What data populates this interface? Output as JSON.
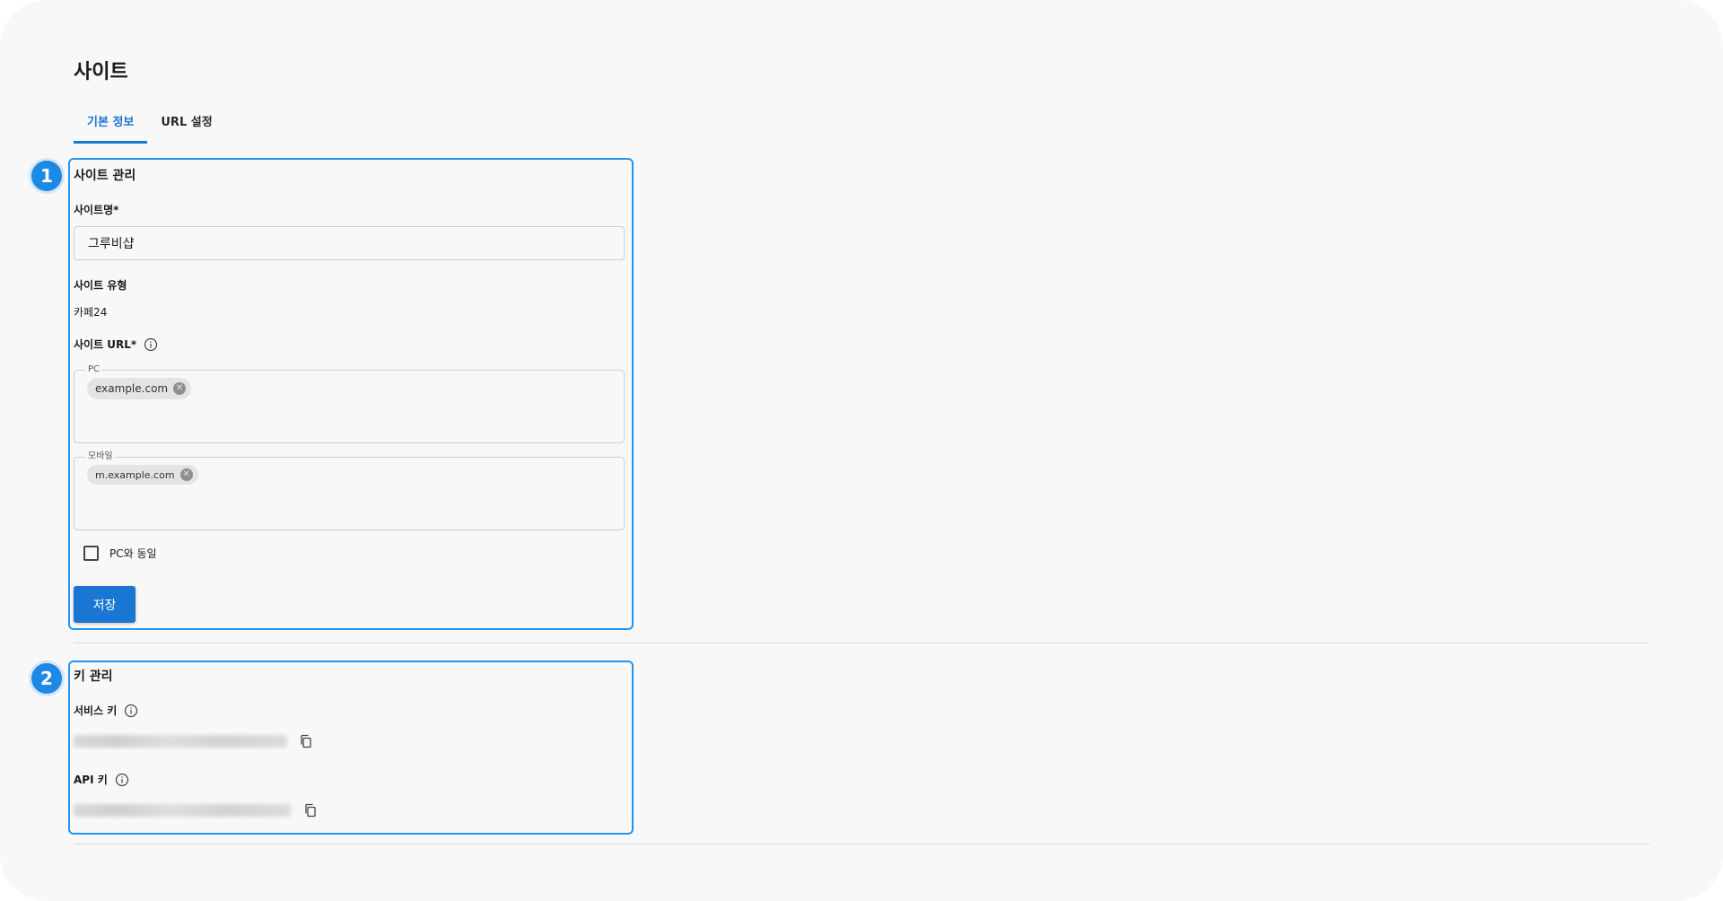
{
  "page": {
    "title": "사이트"
  },
  "tabs": [
    {
      "label": "기본 정보",
      "active": true
    },
    {
      "label": "URL 설정",
      "active": false
    }
  ],
  "markers": [
    "1",
    "2"
  ],
  "site_management": {
    "title": "사이트 관리",
    "site_name": {
      "label": "사이트명*",
      "value": "그루비샵"
    },
    "site_type": {
      "label": "사이트 유형",
      "value": "카페24"
    },
    "site_url": {
      "label": "사이트 URL*",
      "pc": {
        "legend": "PC",
        "chips": [
          "example.com"
        ]
      },
      "mobile": {
        "legend": "모바일",
        "chips": [
          "m.example.com"
        ]
      }
    },
    "same_as_pc": {
      "label": "PC와 동일",
      "checked": false
    },
    "save_label": "저장"
  },
  "key_management": {
    "title": "키 관리",
    "service_key": {
      "label": "서비스 키"
    },
    "api_key": {
      "label": "API 키"
    }
  },
  "colors": {
    "accent": "#1976d2",
    "highlight": "#2196f3"
  }
}
